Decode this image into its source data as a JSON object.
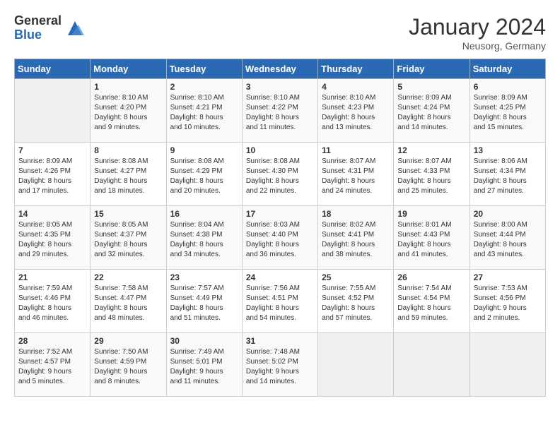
{
  "logo": {
    "general": "General",
    "blue": "Blue"
  },
  "header": {
    "title": "January 2024",
    "location": "Neusorg, Germany"
  },
  "days_of_week": [
    "Sunday",
    "Monday",
    "Tuesday",
    "Wednesday",
    "Thursday",
    "Friday",
    "Saturday"
  ],
  "weeks": [
    [
      {
        "day": "",
        "sunrise": "",
        "sunset": "",
        "daylight": ""
      },
      {
        "day": "1",
        "sunrise": "Sunrise: 8:10 AM",
        "sunset": "Sunset: 4:20 PM",
        "daylight": "Daylight: 8 hours and 9 minutes."
      },
      {
        "day": "2",
        "sunrise": "Sunrise: 8:10 AM",
        "sunset": "Sunset: 4:21 PM",
        "daylight": "Daylight: 8 hours and 10 minutes."
      },
      {
        "day": "3",
        "sunrise": "Sunrise: 8:10 AM",
        "sunset": "Sunset: 4:22 PM",
        "daylight": "Daylight: 8 hours and 11 minutes."
      },
      {
        "day": "4",
        "sunrise": "Sunrise: 8:10 AM",
        "sunset": "Sunset: 4:23 PM",
        "daylight": "Daylight: 8 hours and 13 minutes."
      },
      {
        "day": "5",
        "sunrise": "Sunrise: 8:09 AM",
        "sunset": "Sunset: 4:24 PM",
        "daylight": "Daylight: 8 hours and 14 minutes."
      },
      {
        "day": "6",
        "sunrise": "Sunrise: 8:09 AM",
        "sunset": "Sunset: 4:25 PM",
        "daylight": "Daylight: 8 hours and 15 minutes."
      }
    ],
    [
      {
        "day": "7",
        "sunrise": "Sunrise: 8:09 AM",
        "sunset": "Sunset: 4:26 PM",
        "daylight": "Daylight: 8 hours and 17 minutes."
      },
      {
        "day": "8",
        "sunrise": "Sunrise: 8:08 AM",
        "sunset": "Sunset: 4:27 PM",
        "daylight": "Daylight: 8 hours and 18 minutes."
      },
      {
        "day": "9",
        "sunrise": "Sunrise: 8:08 AM",
        "sunset": "Sunset: 4:29 PM",
        "daylight": "Daylight: 8 hours and 20 minutes."
      },
      {
        "day": "10",
        "sunrise": "Sunrise: 8:08 AM",
        "sunset": "Sunset: 4:30 PM",
        "daylight": "Daylight: 8 hours and 22 minutes."
      },
      {
        "day": "11",
        "sunrise": "Sunrise: 8:07 AM",
        "sunset": "Sunset: 4:31 PM",
        "daylight": "Daylight: 8 hours and 24 minutes."
      },
      {
        "day": "12",
        "sunrise": "Sunrise: 8:07 AM",
        "sunset": "Sunset: 4:33 PM",
        "daylight": "Daylight: 8 hours and 25 minutes."
      },
      {
        "day": "13",
        "sunrise": "Sunrise: 8:06 AM",
        "sunset": "Sunset: 4:34 PM",
        "daylight": "Daylight: 8 hours and 27 minutes."
      }
    ],
    [
      {
        "day": "14",
        "sunrise": "Sunrise: 8:05 AM",
        "sunset": "Sunset: 4:35 PM",
        "daylight": "Daylight: 8 hours and 29 minutes."
      },
      {
        "day": "15",
        "sunrise": "Sunrise: 8:05 AM",
        "sunset": "Sunset: 4:37 PM",
        "daylight": "Daylight: 8 hours and 32 minutes."
      },
      {
        "day": "16",
        "sunrise": "Sunrise: 8:04 AM",
        "sunset": "Sunset: 4:38 PM",
        "daylight": "Daylight: 8 hours and 34 minutes."
      },
      {
        "day": "17",
        "sunrise": "Sunrise: 8:03 AM",
        "sunset": "Sunset: 4:40 PM",
        "daylight": "Daylight: 8 hours and 36 minutes."
      },
      {
        "day": "18",
        "sunrise": "Sunrise: 8:02 AM",
        "sunset": "Sunset: 4:41 PM",
        "daylight": "Daylight: 8 hours and 38 minutes."
      },
      {
        "day": "19",
        "sunrise": "Sunrise: 8:01 AM",
        "sunset": "Sunset: 4:43 PM",
        "daylight": "Daylight: 8 hours and 41 minutes."
      },
      {
        "day": "20",
        "sunrise": "Sunrise: 8:00 AM",
        "sunset": "Sunset: 4:44 PM",
        "daylight": "Daylight: 8 hours and 43 minutes."
      }
    ],
    [
      {
        "day": "21",
        "sunrise": "Sunrise: 7:59 AM",
        "sunset": "Sunset: 4:46 PM",
        "daylight": "Daylight: 8 hours and 46 minutes."
      },
      {
        "day": "22",
        "sunrise": "Sunrise: 7:58 AM",
        "sunset": "Sunset: 4:47 PM",
        "daylight": "Daylight: 8 hours and 48 minutes."
      },
      {
        "day": "23",
        "sunrise": "Sunrise: 7:57 AM",
        "sunset": "Sunset: 4:49 PM",
        "daylight": "Daylight: 8 hours and 51 minutes."
      },
      {
        "day": "24",
        "sunrise": "Sunrise: 7:56 AM",
        "sunset": "Sunset: 4:51 PM",
        "daylight": "Daylight: 8 hours and 54 minutes."
      },
      {
        "day": "25",
        "sunrise": "Sunrise: 7:55 AM",
        "sunset": "Sunset: 4:52 PM",
        "daylight": "Daylight: 8 hours and 57 minutes."
      },
      {
        "day": "26",
        "sunrise": "Sunrise: 7:54 AM",
        "sunset": "Sunset: 4:54 PM",
        "daylight": "Daylight: 8 hours and 59 minutes."
      },
      {
        "day": "27",
        "sunrise": "Sunrise: 7:53 AM",
        "sunset": "Sunset: 4:56 PM",
        "daylight": "Daylight: 9 hours and 2 minutes."
      }
    ],
    [
      {
        "day": "28",
        "sunrise": "Sunrise: 7:52 AM",
        "sunset": "Sunset: 4:57 PM",
        "daylight": "Daylight: 9 hours and 5 minutes."
      },
      {
        "day": "29",
        "sunrise": "Sunrise: 7:50 AM",
        "sunset": "Sunset: 4:59 PM",
        "daylight": "Daylight: 9 hours and 8 minutes."
      },
      {
        "day": "30",
        "sunrise": "Sunrise: 7:49 AM",
        "sunset": "Sunset: 5:01 PM",
        "daylight": "Daylight: 9 hours and 11 minutes."
      },
      {
        "day": "31",
        "sunrise": "Sunrise: 7:48 AM",
        "sunset": "Sunset: 5:02 PM",
        "daylight": "Daylight: 9 hours and 14 minutes."
      },
      {
        "day": "",
        "sunrise": "",
        "sunset": "",
        "daylight": ""
      },
      {
        "day": "",
        "sunrise": "",
        "sunset": "",
        "daylight": ""
      },
      {
        "day": "",
        "sunrise": "",
        "sunset": "",
        "daylight": ""
      }
    ]
  ]
}
